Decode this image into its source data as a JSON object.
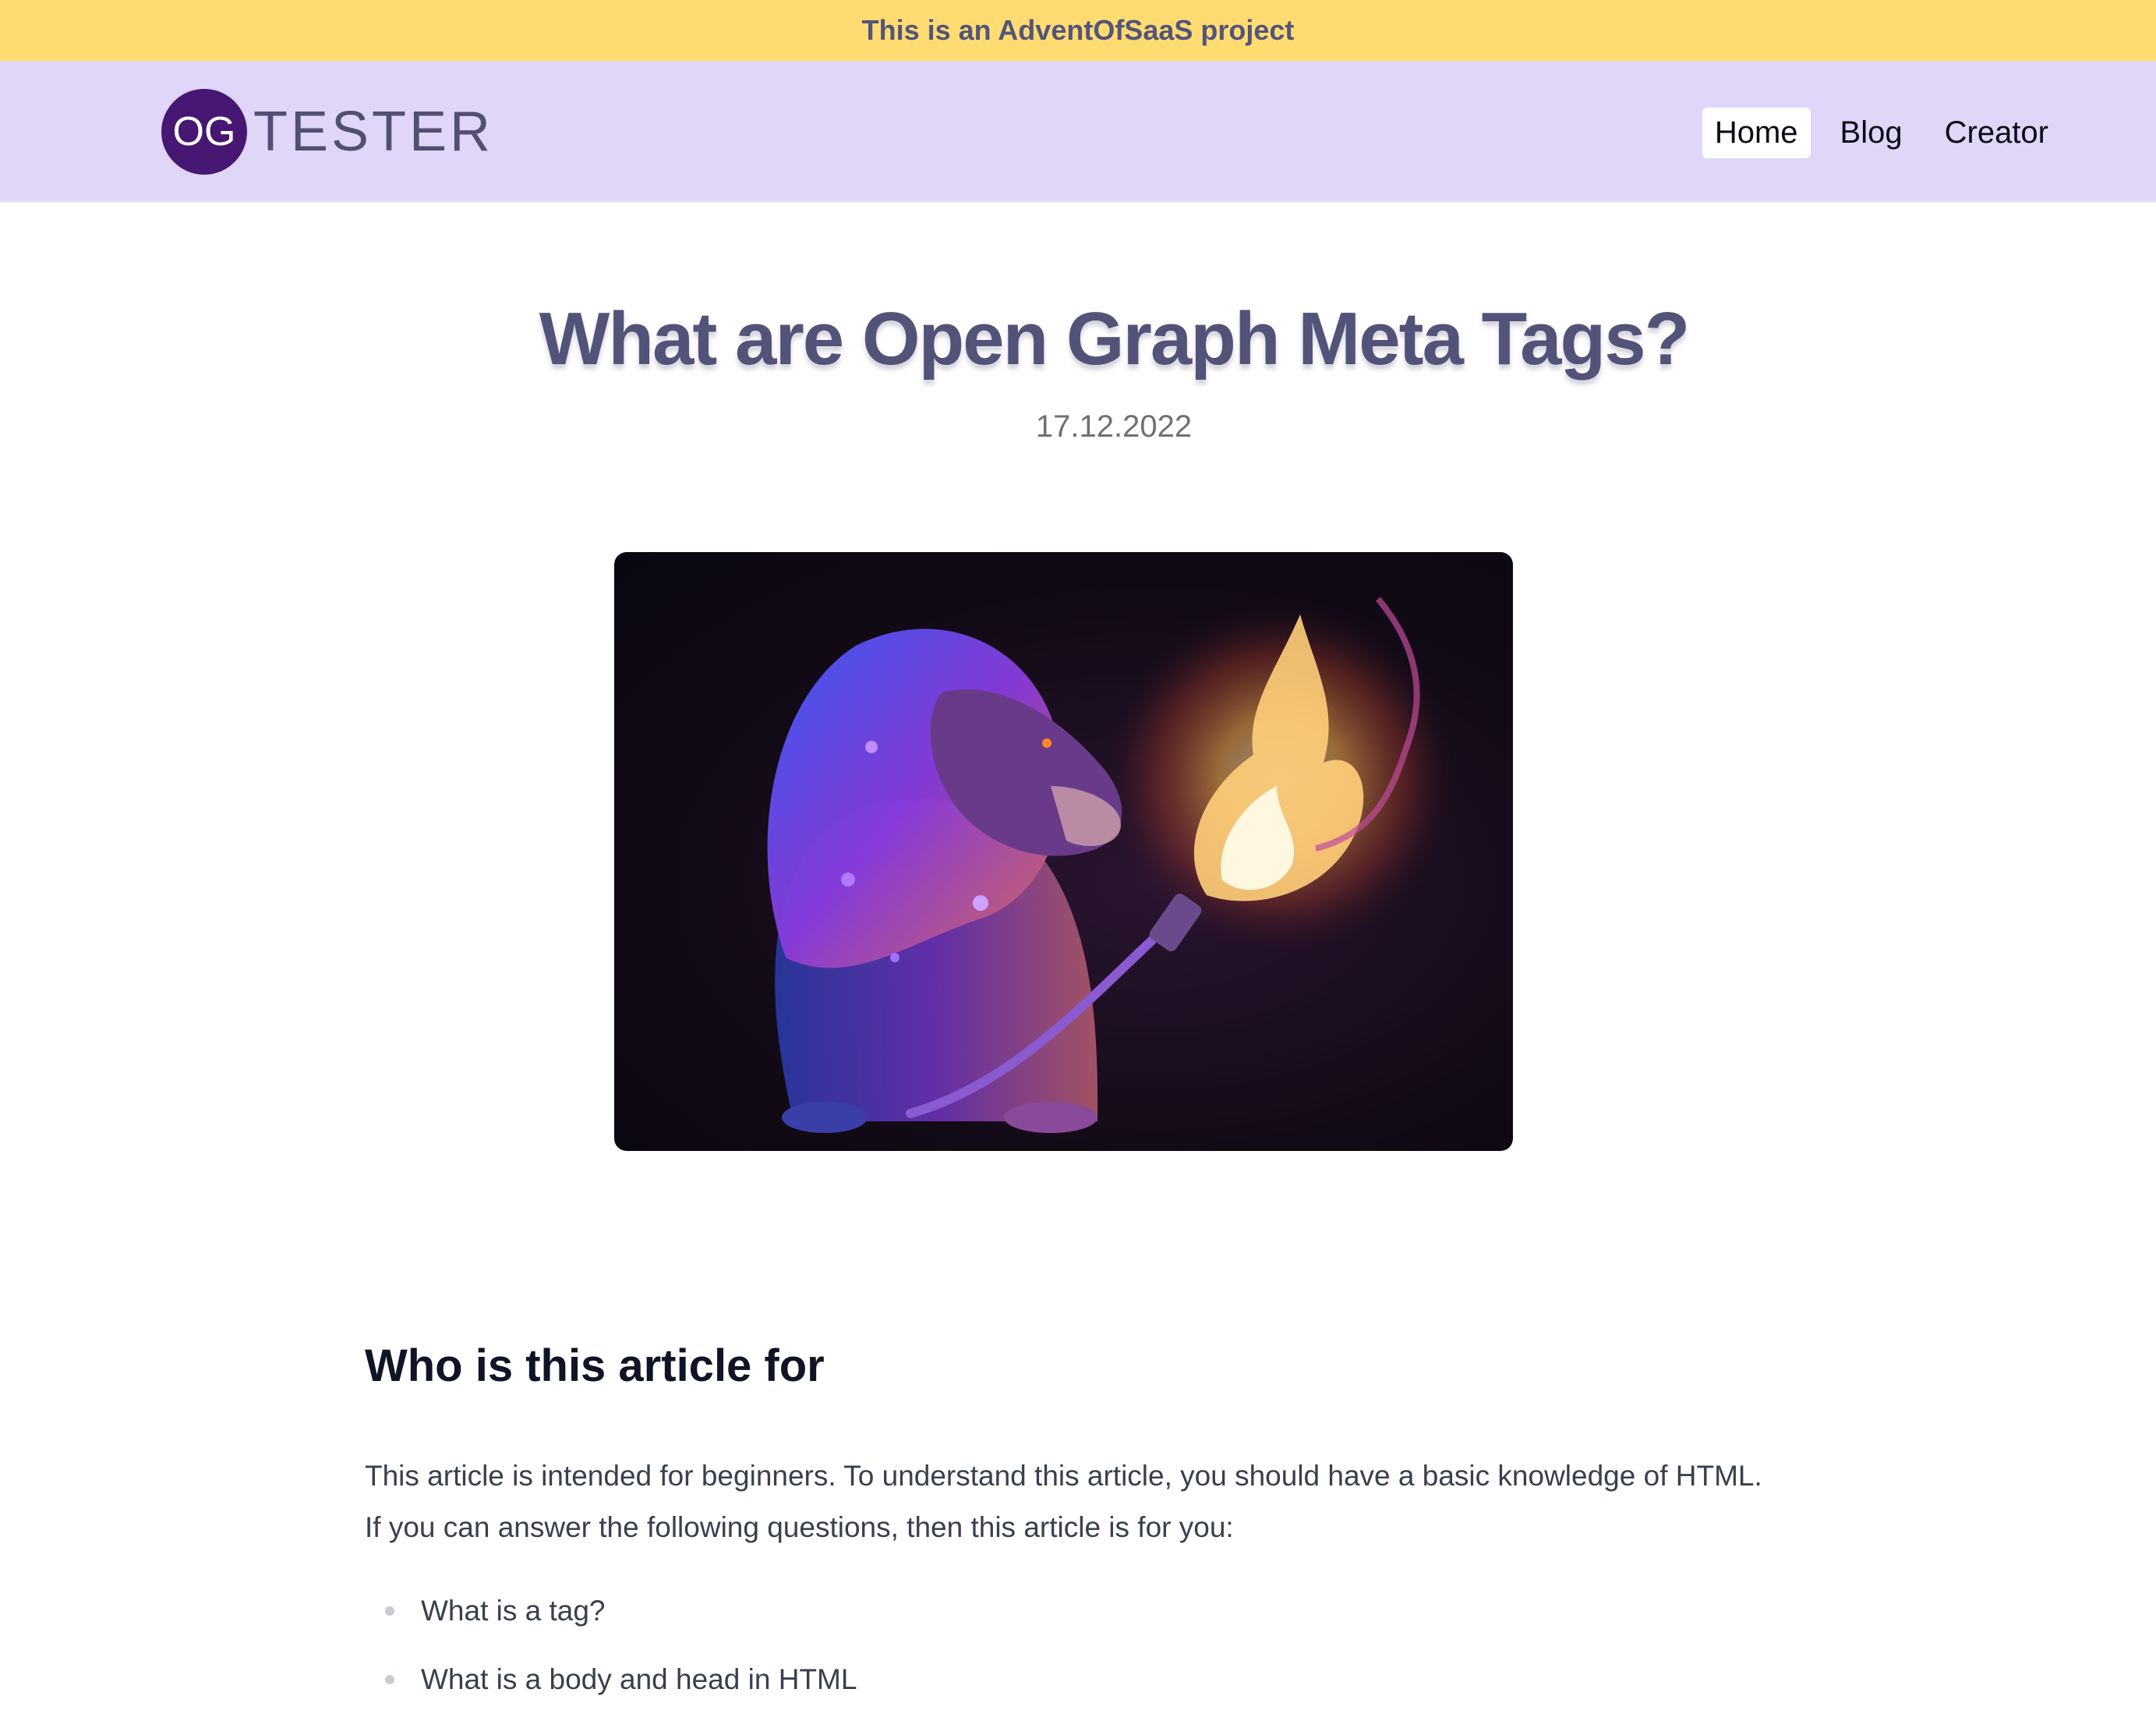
{
  "banner": {
    "text": "This is an AdventOfSaaS project"
  },
  "header": {
    "logo_badge": "OG",
    "logo_word": "TESTER",
    "nav": [
      {
        "label": "Home",
        "active": true
      },
      {
        "label": "Blog",
        "active": false
      },
      {
        "label": "Creator",
        "active": false
      }
    ]
  },
  "article": {
    "title": "What are Open Graph Meta Tags?",
    "date": "17.12.2022",
    "hero_image": "lion with flaming torch illustration",
    "section_heading": "Who is this article for",
    "paragraph": "This article is intended for beginners. To understand this article, you should have a basic knowledge of HTML. If you can answer the following questions, then this article is for you:",
    "bullets": [
      "What is a tag?",
      "What is a body and head in HTML"
    ]
  },
  "colors": {
    "banner_bg": "#FEDC72",
    "navbar_bg": "#E0D6F8",
    "logo_circle": "#461873",
    "title_color": "#535379"
  }
}
